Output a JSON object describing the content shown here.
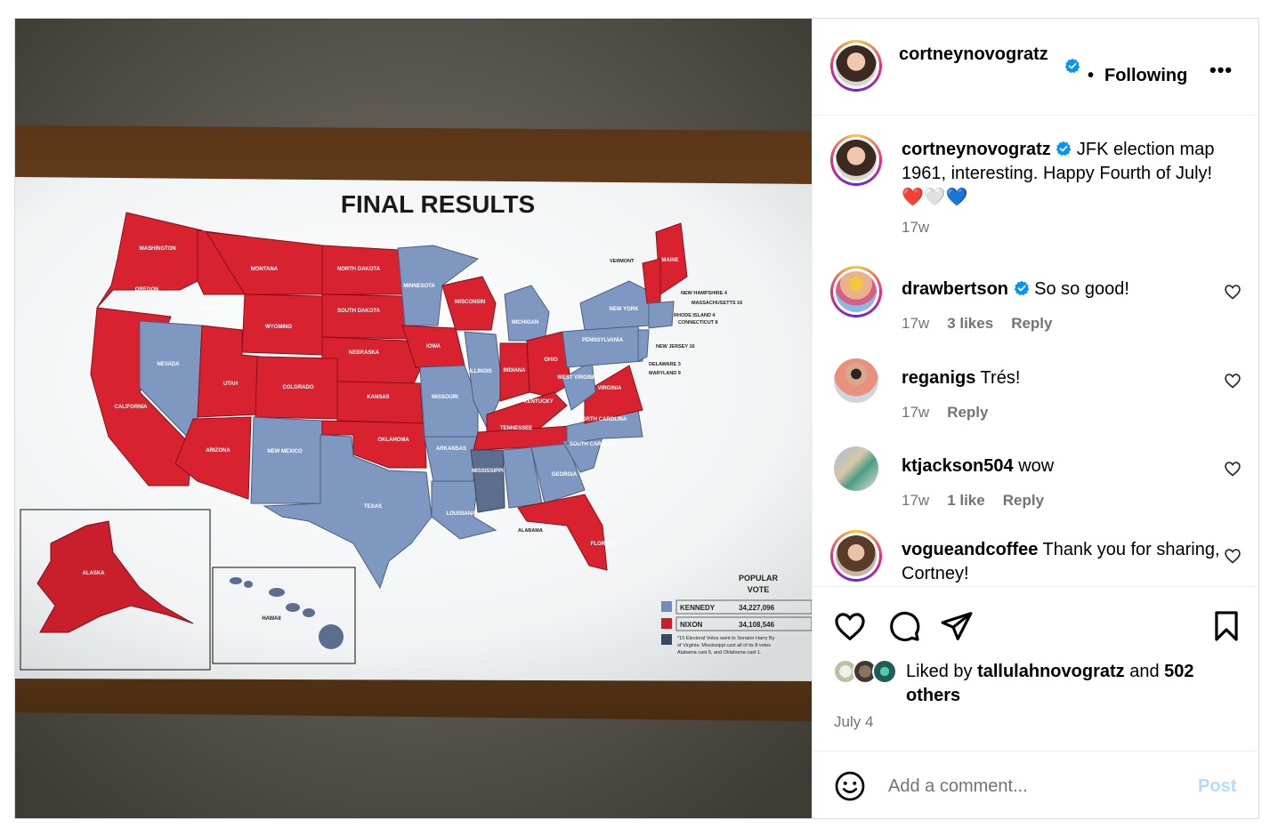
{
  "post": {
    "image": {
      "map_title": "FINAL RESULTS",
      "popular_vote_label": "POPULAR\nVOTE",
      "legend": [
        {
          "name": "KENNEDY",
          "votes": "34,227,096",
          "color": "#6f8cb8"
        },
        {
          "name": "NIXON",
          "votes": "34,108,546",
          "color": "#c91f2c"
        }
      ],
      "footnote": "*15 Electoral Votes went to Senator Harry By... of Virginia: Mississippi cast all of its 8 votes, Alabama cast 6, and Oklahoma cast 1.",
      "states": {
        "washington": "WASHINGTON",
        "oregon": "OREGON",
        "california": "CALIFORNIA",
        "nevada": "NEVADA",
        "idaho": "IDAHO",
        "montana": "MONTANA",
        "wyoming": "WYOMING",
        "utah": "UTAH",
        "arizona": "ARIZONA",
        "colorado": "COLORADO",
        "new_mexico": "NEW MEXICO",
        "north_dakota": "NORTH DAKOTA",
        "south_dakota": "SOUTH DAKOTA",
        "nebraska": "NEBRASKA",
        "kansas": "KANSAS",
        "oklahoma": "OKLAHOMA",
        "texas": "TEXAS",
        "minnesota": "MINNESOTA",
        "iowa": "IOWA",
        "missouri": "MISSOURI",
        "arkansas": "ARKANSAS",
        "louisiana": "LOUISIANA",
        "wisconsin": "WISCONSIN",
        "illinois": "ILLINOIS",
        "michigan": "MICHIGAN",
        "indiana": "INDIANA",
        "ohio": "OHIO",
        "kentucky": "KENTUCKY",
        "tennessee": "TENNESSEE",
        "mississippi": "MISSISSIPPI",
        "alabama": "ALABAMA",
        "georgia": "GEORGIA",
        "florida": "FLORIDA",
        "south_carolina": "SOUTH CAROLINA",
        "north_carolina": "NORTH CAROLINA",
        "virginia": "VIRGINIA",
        "west_virginia": "WEST VIRGINIA",
        "pennsylvania": "PENNSYLVANIA",
        "new_york": "NEW YORK",
        "maine": "MAINE",
        "vermont": "VERMONT",
        "new_hampshire": "NEW HAMPSHIRE 4",
        "massachusetts": "MASSACHUSETTS 16",
        "rhode_island": "RHODE ISLAND 4",
        "connecticut": "CONNECTICUT 8",
        "new_jersey": "NEW JERSEY 16",
        "delaware": "DELAWARE 3",
        "maryland": "MARYLAND 9",
        "alaska": "ALASKA",
        "hawaii": "HAWAII"
      }
    },
    "header": {
      "username": "cortneynovogratz",
      "dot": "•",
      "follow_state": "Following",
      "more": "•••"
    },
    "caption": {
      "username": "cortneynovogratz",
      "text": " JFK election map 1961, interesting. Happy Fourth of July! ❤️🤍💙",
      "age": "17w"
    },
    "comments": [
      {
        "username": "drawbertson",
        "verified": true,
        "text": " So so good!",
        "age": "17w",
        "likes": "3 likes",
        "reply": "Reply"
      },
      {
        "username": "reganigs",
        "verified": false,
        "text": " Trés!",
        "age": "17w",
        "likes": "",
        "reply": "Reply"
      },
      {
        "username": "ktjackson504",
        "verified": false,
        "text": " wow",
        "age": "17w",
        "likes": "1 like",
        "reply": "Reply"
      },
      {
        "username": "vogueandcoffee",
        "verified": false,
        "text": " Thank you for sharing, Cortney!",
        "age": "",
        "likes": "",
        "reply": ""
      }
    ],
    "actions": {
      "icons": [
        "heart-icon",
        "comment-icon",
        "share-icon",
        "bookmark-icon"
      ],
      "liked_by_prefix": "Liked by ",
      "liked_by_user": "tallulahnovogratz",
      "liked_by_mid": " and ",
      "liked_by_count": "502",
      "liked_by_suffix": " others",
      "date": "July 4"
    },
    "add_comment": {
      "placeholder": "Add a comment...",
      "post_label": "Post"
    },
    "colors": {
      "verified": "#0095f6",
      "muted": "#737373",
      "post_disabled": "#b3dbff",
      "map_red": "#d8222f",
      "map_blue": "#7f98c2"
    }
  }
}
